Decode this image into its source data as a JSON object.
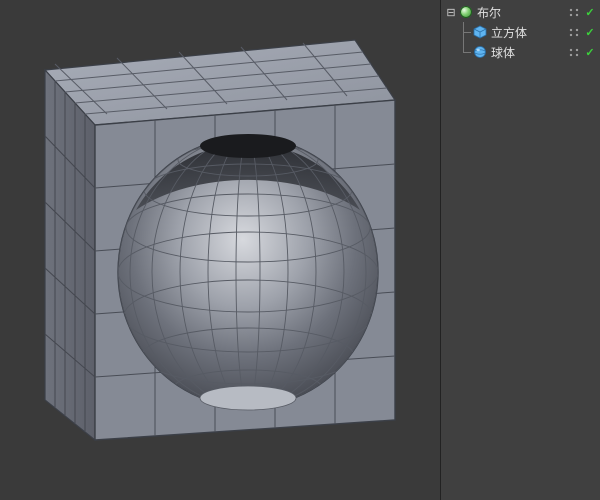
{
  "viewport": {
    "background": "#3a3a3a",
    "cube_fill": "#7f8490",
    "cube_edge": "#3b3f47",
    "cavity_fill": "#6c707a"
  },
  "hierarchy": [
    {
      "id": "boole",
      "level": 0,
      "icon": "boole-icon",
      "label": "布尔",
      "expanded": true,
      "visible": true,
      "render": true,
      "last": false
    },
    {
      "id": "cube",
      "level": 1,
      "icon": "cube-icon",
      "label": "立方体",
      "expanded": null,
      "visible": true,
      "render": true,
      "last": false
    },
    {
      "id": "sphere",
      "level": 1,
      "icon": "sphere-icon",
      "label": "球体",
      "expanded": null,
      "visible": true,
      "render": true,
      "last": true
    }
  ],
  "glyphs": {
    "expanded": "⊟",
    "collapsed": "⊞",
    "check": "✓"
  }
}
